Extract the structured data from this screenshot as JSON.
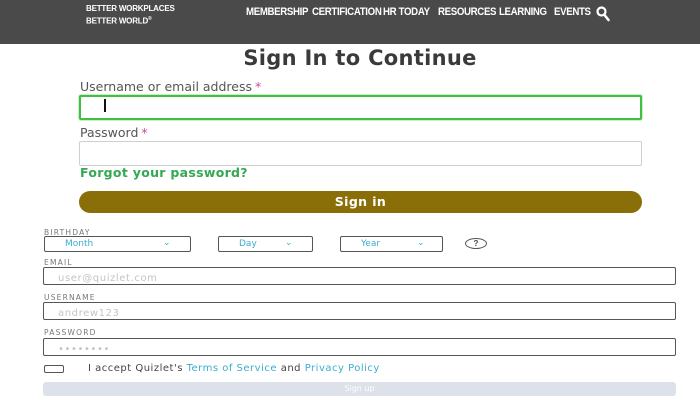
{
  "header": {
    "logo_line1": "BETTER WORKPLACES",
    "logo_line2": "BETTER WORLD",
    "logo_mark": "®",
    "nav": [
      "MEMBERSHIP",
      "CERTIFICATION",
      "HR TODAY",
      "RESOURCES",
      "LEARNING",
      "EVENTS"
    ],
    "search_icon": "search-icon"
  },
  "signin": {
    "title": "Sign In to Continue",
    "username_label": "Username or email address",
    "password_label": "Password",
    "required_mark": "*",
    "username_value": "",
    "password_value": "",
    "forgot_link": "Forgot your password?",
    "submit_label": "Sign in"
  },
  "signup": {
    "birthday_label": "BIRTHDAY",
    "month_placeholder": "Month",
    "day_placeholder": "Day",
    "year_placeholder": "Year",
    "help_icon": "?",
    "email_label": "EMAIL",
    "email_placeholder": "user@quizlet.com",
    "username_label": "USERNAME",
    "username_placeholder": "andrew123",
    "password_label": "PASSWORD",
    "password_placeholder": "••••••••",
    "accept_prefix": "I accept Quizlet's",
    "terms_link": "Terms of Service",
    "and_text": "and",
    "privacy_link": "Privacy Policy",
    "submit_label": "Sign up"
  },
  "colors": {
    "nav_bg": "#4a4a4a",
    "focus_green": "#3fc13f",
    "link_green": "#34a853",
    "signin_button": "#8a6e08",
    "link_blue": "#3aaecf",
    "signup_button": "#dde1ea"
  }
}
